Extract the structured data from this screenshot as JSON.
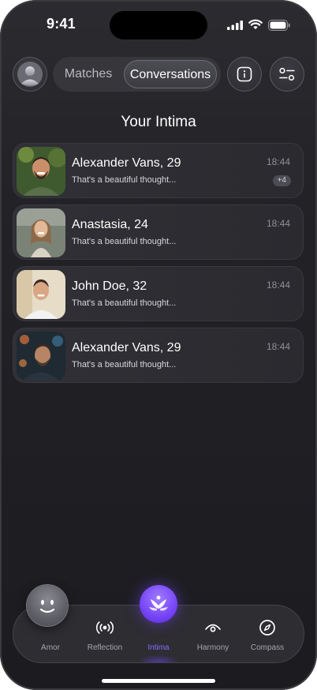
{
  "status": {
    "time": "9:41"
  },
  "segmented": {
    "tabs": [
      "Matches",
      "Conversations"
    ],
    "active": "Conversations"
  },
  "title": "Your Intima",
  "conversations": [
    {
      "name": "Alexander Vans, 29",
      "message": "That's a  beautiful thought...",
      "time": "18:44",
      "badge": "+4"
    },
    {
      "name": "Anastasia, 24",
      "message": "That's a  beautiful thought...",
      "time": "18:44"
    },
    {
      "name": "John Doe, 32",
      "message": "That's a  beautiful thought...",
      "time": "18:44"
    },
    {
      "name": "Alexander Vans, 29",
      "message": "That's a  beautiful thought...",
      "time": "18:44"
    }
  ],
  "tabbar": {
    "items": [
      {
        "label": "Amor",
        "icon": "smile-orb-icon"
      },
      {
        "label": "Reflection",
        "icon": "broadcast-icon"
      },
      {
        "label": "Intima",
        "icon": "wings-icon"
      },
      {
        "label": "Harmony",
        "icon": "eye-icon"
      },
      {
        "label": "Compass",
        "icon": "compass-icon"
      }
    ],
    "active": "Intima"
  },
  "colors": {
    "accent": "#7a4dff",
    "background": "#1f1f23",
    "card": "#2c2c31"
  }
}
